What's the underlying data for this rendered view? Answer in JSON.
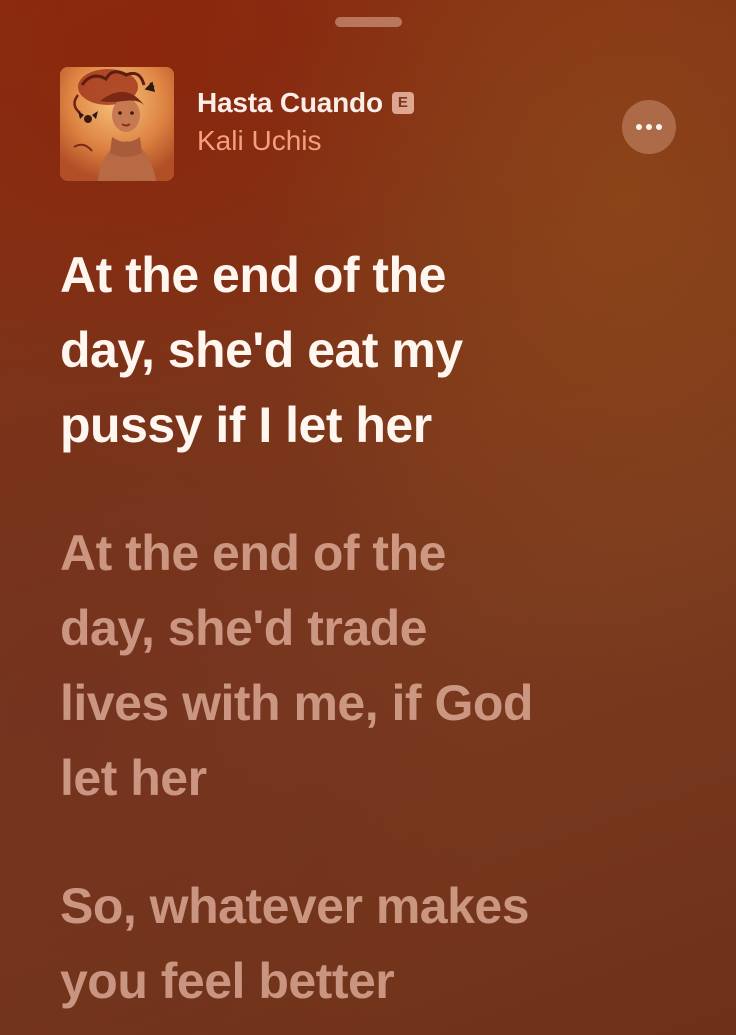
{
  "track": {
    "title": "Hasta Cuando",
    "explicit_badge": "E",
    "artist": "Kali Uchis"
  },
  "icons": {
    "grabber": "drag-handle",
    "more": "ellipsis-icon",
    "artwork": "album-artwork"
  },
  "lyrics": [
    {
      "text": "At the end of the\nday, she'd eat my\npussy if I let her",
      "state": "active"
    },
    {
      "text": "At the end of the\nday, she'd trade\nlives with me, if God\nlet her",
      "state": "upcoming"
    },
    {
      "text": "So, whatever makes\nyou feel better",
      "state": "upcoming"
    }
  ],
  "colors": {
    "background_top": "#8a2e12",
    "background_bottom": "#6e3118",
    "title": "#fbeee8",
    "artist": "#f4a07e",
    "active_lyric": "#fff6f0",
    "upcoming_lyric": "#ffd2be"
  }
}
